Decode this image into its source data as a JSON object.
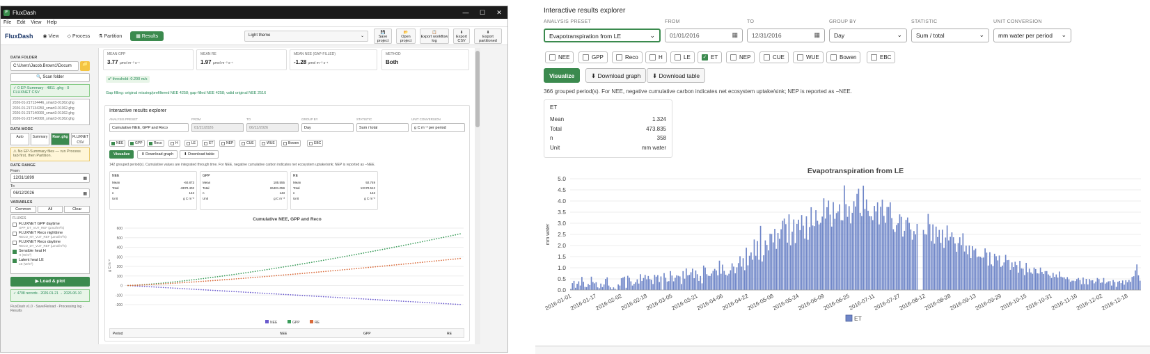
{
  "window": {
    "title": "FluxDash",
    "menu": [
      "File",
      "Edit",
      "View",
      "Help"
    ],
    "controls": [
      "—",
      "☐",
      "✕"
    ]
  },
  "toolbar": {
    "brand": "FluxDash",
    "tabs": [
      "View",
      "Process",
      "Partition",
      "Results"
    ],
    "tab_icons": [
      "◉",
      "◇",
      "⚗",
      "▦"
    ],
    "active": "Results",
    "theme": "Light theme",
    "buttons": [
      {
        "label": "Save project",
        "icon": "💾"
      },
      {
        "label": "Open project",
        "icon": "📂"
      },
      {
        "label": "Export workflow log",
        "icon": "📋"
      },
      {
        "label": "Export CSV",
        "icon": "⬇"
      },
      {
        "label": "Export partitioned",
        "icon": "⬇"
      }
    ]
  },
  "sidebar": {
    "folder_heading": "DATA FOLDER",
    "folder_path": "C:\\Users\\Jacob.Brown1\\Docum",
    "scan": "🔍 Scan folder",
    "summary_status": "✓ 0 EP-Summary · 4811 .ghg · 0 FLUXNET CSV",
    "files": [
      "2026-01-21T134446_smart3-01362.ghg",
      "2026-01-21T134250_smart3-01362.ghg",
      "2026-01-21T140000_smart3-01362.ghg",
      "2026-01-21T140000_smart3-01362.ghg"
    ],
    "mode_heading": "DATA MODE",
    "modes": [
      "Auto",
      "Summary",
      "Raw .ghg",
      "FLUXNET CSV"
    ],
    "mode_active": "Raw .ghg",
    "warn": "⚠ No EP-Summary files — run Process tab first, then Partition.",
    "range_heading": "DATE RANGE",
    "from_label": "From",
    "from": "12/31/1899",
    "to_label": "To",
    "to": "06/12/2026",
    "vars_heading": "VARIABLES",
    "var_buttons": [
      "Common",
      "All",
      "Clear"
    ],
    "vars_group": "FLUXES",
    "vars": [
      {
        "name": "FLUXNET GPP daytime",
        "sub": "GPP_DT_VUT_REF (µmol/m²/s)",
        "on": false
      },
      {
        "name": "FLUXNET Reco nighttime",
        "sub": "RECO_NT_VUT_REF (µmol/m²/s)",
        "on": false
      },
      {
        "name": "FLUXNET Reco daytime",
        "sub": "RECO_DT_VUT_REF (µmol/m²/s)",
        "on": false
      },
      {
        "name": "Sensible heat H",
        "sub": "H (W/m²)",
        "on": true
      },
      {
        "name": "Latent heat LE",
        "sub": "LE (W/m²)",
        "on": true
      }
    ],
    "load": "▶ Load & plot",
    "records": "✓ 4708 records · 2026-01-21 → 2026-06-10",
    "footer": "FluxDash v1.0 · Save/Reload · Processing log · Results"
  },
  "main": {
    "kpis": [
      {
        "label": "MEAN GPP",
        "value": "3.77",
        "unit": "µmol m⁻² s⁻¹"
      },
      {
        "label": "MEAN RE",
        "value": "1.97",
        "unit": "µmol m⁻² s⁻¹"
      },
      {
        "label": "MEAN NEE (GAP-FILLED)",
        "value": "-1.28",
        "unit": "µmol m⁻² s⁻¹"
      },
      {
        "label": "METHOD",
        "value": "Both",
        "unit": ""
      }
    ],
    "ustar": "u* threshold: 0.200 m/s",
    "gap": "Gap filling: original missing/prefiltered NEE 4258; gap-filled NEE 4258; valid original NEE 2516",
    "explorer": {
      "title": "Interactive results explorer",
      "labels": [
        "ANALYSIS PRESET",
        "FROM",
        "TO",
        "GROUP BY",
        "STATISTIC",
        "UNIT CONVERSION"
      ],
      "preset": "Cumulative NEE, GPP and Reco",
      "from": "01/21/2026",
      "to": "06/11/2026",
      "group": "Day",
      "stat": "Sum / total",
      "unit": "g C m⁻² per period",
      "checks": [
        {
          "l": "NEE",
          "on": true
        },
        {
          "l": "GPP",
          "on": true
        },
        {
          "l": "Reco",
          "on": true
        },
        {
          "l": "H",
          "on": false
        },
        {
          "l": "LE",
          "on": false
        },
        {
          "l": "ET",
          "on": false
        },
        {
          "l": "NEP",
          "on": false
        },
        {
          "l": "CUE",
          "on": false
        },
        {
          "l": "WUE",
          "on": false
        },
        {
          "l": "Bowen",
          "on": false
        },
        {
          "l": "EBC",
          "on": false
        }
      ],
      "buttons": [
        "Visualize",
        "⬇ Download graph",
        "⬇ Download table"
      ],
      "note": "142 grouped period(s). Cumulative values are integrated through time. For NEE, negative cumulative carbon indicates net ecosystem uptake/sink; NEP is reported as −NEE.",
      "stats": [
        {
          "name": "NEE",
          "rows": [
            [
              "Mean",
              "-60.873"
            ],
            [
              "Total",
              "-8970.402"
            ],
            [
              "n",
              "143"
            ],
            [
              "Unit",
              "g C m⁻²"
            ]
          ]
        },
        {
          "name": "GPP",
          "rows": [
            [
              "Mean",
              "185.555"
            ],
            [
              "Total",
              "26401.059"
            ],
            [
              "n",
              "143"
            ],
            [
              "Unit",
              "g C m⁻²"
            ]
          ]
        },
        {
          "name": "RE",
          "rows": [
            [
              "Mean",
              "92.749"
            ],
            [
              "Total",
              "13170.512"
            ],
            [
              "n",
              "143"
            ],
            [
              "Unit",
              "g C m⁻²"
            ]
          ]
        }
      ],
      "chart_title": "Cumulative NEE, GPP and Reco",
      "ylabel": "g C m⁻²",
      "yticks": [
        "600",
        "500",
        "400",
        "300",
        "200",
        "100",
        "0",
        "-100",
        "-200"
      ],
      "legend": [
        "NEE",
        "GPP",
        "RE"
      ],
      "table_head": [
        "Period",
        "NEE",
        "GPP",
        "RE"
      ]
    }
  },
  "right": {
    "title": "Interactive results explorer",
    "labels": [
      "ANALYSIS PRESET",
      "FROM",
      "TO",
      "GROUP BY",
      "STATISTIC",
      "UNIT CONVERSION"
    ],
    "preset": "Evapotranspiration from LE",
    "from": "01/01/2016",
    "to": "12/31/2016",
    "group": "Day",
    "stat": "Sum / total",
    "unit": "mm water per period",
    "checks": [
      {
        "l": "NEE",
        "on": false
      },
      {
        "l": "GPP",
        "on": false
      },
      {
        "l": "Reco",
        "on": false
      },
      {
        "l": "H",
        "on": false
      },
      {
        "l": "LE",
        "on": false
      },
      {
        "l": "ET",
        "on": true
      },
      {
        "l": "NEP",
        "on": false
      },
      {
        "l": "CUE",
        "on": false
      },
      {
        "l": "WUE",
        "on": false
      },
      {
        "l": "Bowen",
        "on": false
      },
      {
        "l": "EBC",
        "on": false
      }
    ],
    "buttons": [
      "Visualize",
      "⬇ Download graph",
      "⬇ Download table"
    ],
    "note": "366 grouped period(s). For NEE, negative cumulative carbon indicates net ecosystem uptake/sink; NEP is reported as −NEE.",
    "stat_name": "ET",
    "stat_rows": [
      [
        "Mean",
        "1.324"
      ],
      [
        "Total",
        "473.835"
      ],
      [
        "n",
        "358"
      ],
      [
        "Unit",
        "mm water"
      ]
    ]
  },
  "chart_data": {
    "type": "bar",
    "title": "Evapotranspiration from LE",
    "xlabel": "",
    "ylabel": "mm water",
    "ylim": [
      0,
      5
    ],
    "yticks": [
      0,
      0.5,
      1,
      1.5,
      2,
      2.5,
      3,
      3.5,
      4,
      4.5,
      5
    ],
    "xtick_labels": [
      "2016-01-01",
      "2016-01-17",
      "2016-02-02",
      "2016-02-18",
      "2016-03-05",
      "2016-03-21",
      "2016-04-06",
      "2016-04-22",
      "2016-05-08",
      "2016-05-24",
      "2016-06-09",
      "2016-06-25",
      "2016-07-11",
      "2016-07-27",
      "2016-08-12",
      "2016-08-28",
      "2016-09-13",
      "2016-09-29",
      "2016-10-15",
      "2016-10-31",
      "2016-11-16",
      "2016-12-02",
      "2016-12-18"
    ],
    "legend": [
      "ET"
    ],
    "color": "#6f86c8",
    "series": [
      {
        "name": "ET",
        "x_start": "2016-01-01",
        "values": [
          0.05,
          0.31,
          0.41,
          0.1,
          0.28,
          0.39,
          0.2,
          0.59,
          0.37,
          0.14,
          0.13,
          0.27,
          0.22,
          0.6,
          0.36,
          0.3,
          0.35,
          0.12,
          0.08,
          0.29,
          0.13,
          0.25,
          0.5,
          0.57,
          0.2,
          0.12,
          0.03,
          0.12,
          0.06,
          0.0,
          0.25,
          0.2,
          0.53,
          0.56,
          0.6,
          0.1,
          0.64,
          0.55,
          0.39,
          0.2,
          0.28,
          0.35,
          0.48,
          0.29,
          0.71,
          0.41,
          0.54,
          0.68,
          0.48,
          0.63,
          0.49,
          0.46,
          0.27,
          0.68,
          0.6,
          0.67,
          0.36,
          0.61,
          0.0,
          0.76,
          0.55,
          0.38,
          0.4,
          0.85,
          0.65,
          0.39,
          0.55,
          0.66,
          0.64,
          0.61,
          0.27,
          0.85,
          0.51,
          0.97,
          0.66,
          0.68,
          0.8,
          0.96,
          0.53,
          0.88,
          0.71,
          0.41,
          0.63,
          0.3,
          1.1,
          1.01,
          0.71,
          0.64,
          0.63,
          0.74,
          0.86,
          0.95,
          0.88,
          0.66,
          1.32,
          0.73,
          1.14,
          0.86,
          0.69,
          0.65,
          0.73,
          0.89,
          1.2,
          1.05,
          0.75,
          1.02,
          1.21,
          1.52,
          1.05,
          1.43,
          0.89,
          1.9,
          1.11,
          1.54,
          1.69,
          1.36,
          2.27,
          1.54,
          2.2,
          1.36,
          2.88,
          1.28,
          1.56,
          2.23,
          2.03,
          1.78,
          2.53,
          2.52,
          2.14,
          2.75,
          1.85,
          2.56,
          2.3,
          2.73,
          3.11,
          3.21,
          2.96,
          2.13,
          3.4,
          2.01,
          2.62,
          3.17,
          2.11,
          2.97,
          3.16,
          2.69,
          3.37,
          2.89,
          2.31,
          3.31,
          2.26,
          2.83,
          3.72,
          2.9,
          2.87,
          3.59,
          3.11,
          2.95,
          3.02,
          3.3,
          4.12,
          3.21,
          3.72,
          4.02,
          3.39,
          2.85,
          3.95,
          3.2,
          3.46,
          3.53,
          3.85,
          3.14,
          3.13,
          4.7,
          3.86,
          3.29,
          3.77,
          2.99,
          3.47,
          3.99,
          3.75,
          4.32,
          4.55,
          3.47,
          3.32,
          4.69,
          3.64,
          4.07,
          3.56,
          3.32,
          3.31,
          3.14,
          3.78,
          3.53,
          3.94,
          2.95,
          3.74,
          4.06,
          3.33,
          3.02,
          3.73,
          3.73,
          3.94,
          3.23,
          2.73,
          2.61,
          2.92,
          3.0,
          3.4,
          3.29,
          2.4,
          2.66,
          3.15,
          3.26,
          3.02,
          2.72,
          2.26,
          2.65,
          2.5,
          2.97,
          0.0,
          0.0,
          0.0,
          2.7,
          2.51,
          2.49,
          3.42,
          2.96,
          2.2,
          2.95,
          2.08,
          2.85,
          2.38,
          2.7,
          2.12,
          2.71,
          1.89,
          2.36,
          2.9,
          2.23,
          2.39,
          2.59,
          2.37,
          2.09,
          1.72,
          2.11,
          2.37,
          2.02,
          2.55,
          1.73,
          1.99,
          1.61,
          2.0,
          1.44,
          1.97,
          1.79,
          1.86,
          1.48,
          1.51,
          1.49,
          1.45,
          1.46,
          1.87,
          1.68,
          1.1,
          1.7,
          1.15,
          1.08,
          1.63,
          1.52,
          1.33,
          1.55,
          1.04,
          1.1,
          1.24,
          1.58,
          1.34,
          1.35,
          0.91,
          1.24,
          1.03,
          1.27,
          1.12,
          0.78,
          1.31,
          0.97,
          0.96,
          0.67,
          1.22,
          0.8,
          0.96,
          0.79,
          0.73,
          1.01,
          0.94,
          0.75,
          0.74,
          1.01,
          0.81,
          0.72,
          0.85,
          0.85,
          0.7,
          0.64,
          0.54,
          0.77,
          0.59,
          0.7,
          0.56,
          0.83,
          0.6,
          0.57,
          0.57,
          0.49,
          0.58,
          0.48,
          0.37,
          0.42,
          0.42,
          0.4,
          0.49,
          0.54,
          0.45,
          0.26,
          0.56,
          0.27,
          0.5,
          0.25,
          0.49,
          0.43,
          0.44,
          0.3,
          0.38,
          0.54,
          0.49,
          0.32,
          0.34,
          0.54,
          0.29,
          0.34,
          0.39,
          0.4,
          0.2,
          0.45,
          0.36,
          0.14,
          0.37,
          0.41,
          0.31,
          0.43,
          0.24,
          0.44,
          0.35,
          0.45,
          0.37,
          0.59,
          0.62,
          0.88,
          1.15,
          0.66,
          0.42
        ]
      }
    ]
  }
}
